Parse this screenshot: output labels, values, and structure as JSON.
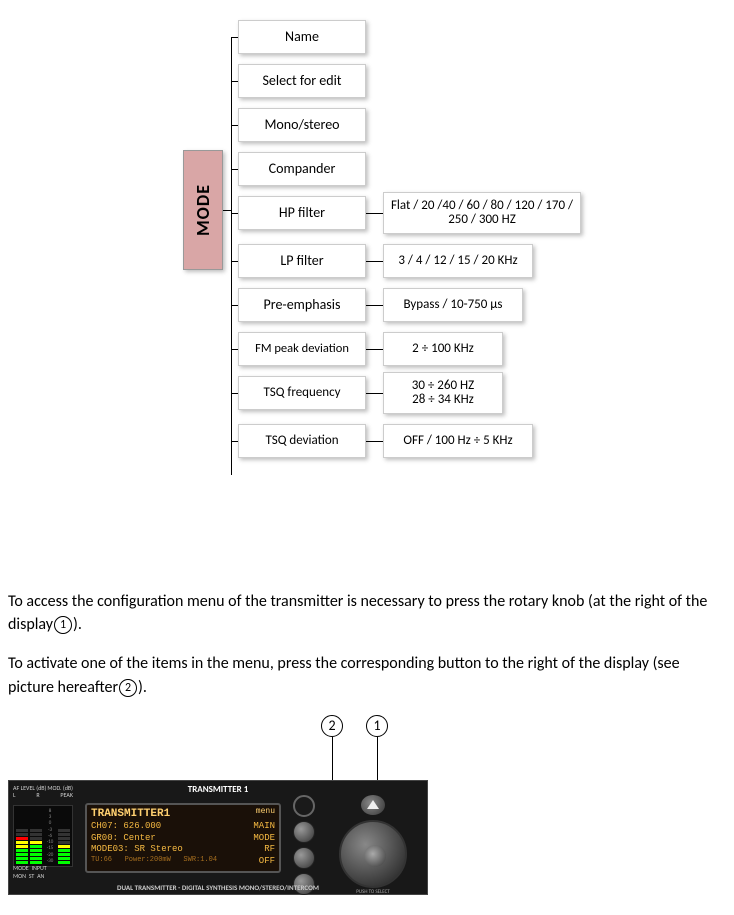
{
  "diagram": {
    "mode": "MODE",
    "items": [
      {
        "label": "Name",
        "value": null
      },
      {
        "label": "Select for edit",
        "value": null
      },
      {
        "label": "Mono/stereo",
        "value": null
      },
      {
        "label": "Compander",
        "value": null
      },
      {
        "label": "HP filter",
        "value": "Flat / 20 /40 / 60 / 80 / 120 / 170 / 250 / 300 HZ"
      },
      {
        "label": "LP filter",
        "value": "3 / 4 / 12 / 15 / 20 KHz"
      },
      {
        "label": "Pre-emphasis",
        "value": "Bypass / 10-750 µs"
      },
      {
        "label": "FM peak deviation",
        "value": "2 ÷ 100 KHz"
      },
      {
        "label": "TSQ frequency",
        "value": "30 ÷ 260 HZ\n28 ÷ 34 KHz"
      },
      {
        "label": "TSQ deviation",
        "value": "OFF / 100 Hz ÷ 5 KHz"
      }
    ]
  },
  "text": {
    "p1a": "To access the configuration menu of the transmitter is necessary to press the rotary knob (at the right of the display",
    "p1b": ").",
    "p2a": "To activate one of the items in the menu, press the corresponding button to the right of the display (see picture hereafter",
    "p2b": ")."
  },
  "callouts": {
    "one": "1",
    "two": "2"
  },
  "device": {
    "title": "TRANSMITTER 1",
    "af_level": "AF LEVEL (dB)",
    "mod": "MOD. (dB)",
    "lr": {
      "l": "L",
      "r": "R",
      "peak": "PEAK"
    },
    "scale": [
      "8",
      "3",
      "0",
      "-3",
      "-6",
      "-10",
      "-15",
      "-20",
      "-30"
    ],
    "bottom": {
      "mode": "MODE",
      "input": "INPUT",
      "mon": "MON",
      "st": "ST",
      "an": "AN"
    },
    "lcd": {
      "line1_left": "TRANSMITTER1",
      "line1_right": "menu",
      "line2_left": "CH07: 626.000",
      "line2_right": "MAIN",
      "line3_left": "GR00: Center",
      "line3_right": "MODE",
      "line4_left": "MODE03: SR Stereo",
      "line4_right": "RF",
      "line5_left": "TU:66   Power:200mW   SWR:1.04",
      "line5_right": "OFF"
    },
    "knob_label": "PUSH TO SELECT",
    "footer": "DUAL TRANSMITTER - DIGITAL SYNTHESIS MONO/STEREO/INTERCOM"
  }
}
